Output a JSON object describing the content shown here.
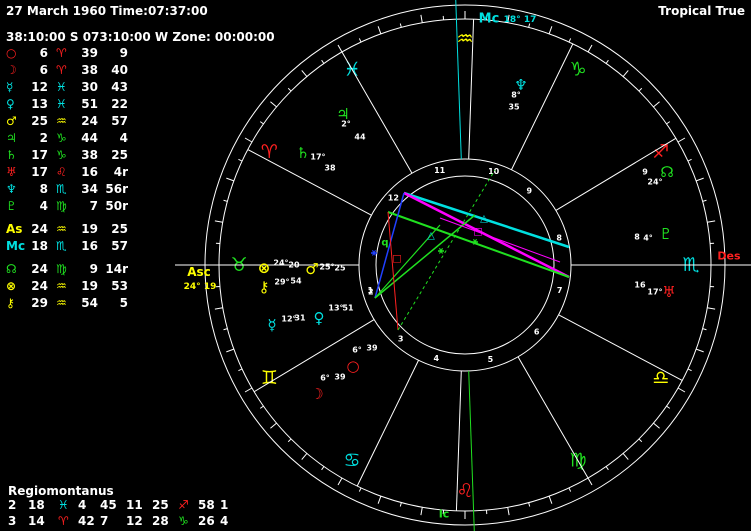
{
  "header": {
    "datetime": "27 March 1960 Time:07:37:00",
    "location": "38:10:00 S 073:10:00 W Zone: 00:00:00",
    "zodiac": "Tropical True"
  },
  "colors": {
    "red": "#ff2020",
    "yellow": "#ffff00",
    "cyan": "#00e0e0",
    "green": "#20e020",
    "white": "#ffffff",
    "magenta": "#ff00ff",
    "blue": "#2040ff"
  },
  "planets": [
    {
      "symbol": "○",
      "name": "Sun",
      "deg": "6",
      "sign": "♈",
      "min": "39",
      "sec": "9",
      "color": "#ff2020"
    },
    {
      "symbol": "☽",
      "name": "Moon",
      "deg": "6",
      "sign": "♈",
      "min": "38",
      "sec": "40",
      "color": "#ff2020"
    },
    {
      "symbol": "☿",
      "name": "Mercury",
      "deg": "12",
      "sign": "♓",
      "min": "30",
      "sec": "43",
      "color": "#00e0e0"
    },
    {
      "symbol": "♀",
      "name": "Venus",
      "deg": "13",
      "sign": "♓",
      "min": "51",
      "sec": "22",
      "color": "#00e0e0"
    },
    {
      "symbol": "♂",
      "name": "Mars",
      "deg": "25",
      "sign": "♒",
      "min": "24",
      "sec": "57",
      "color": "#ffff00"
    },
    {
      "symbol": "♃",
      "name": "Jupiter",
      "deg": "2",
      "sign": "♑",
      "min": "44",
      "sec": "4",
      "color": "#20e020"
    },
    {
      "symbol": "♄",
      "name": "Saturn",
      "deg": "17",
      "sign": "♑",
      "min": "38",
      "sec": "25",
      "color": "#20e020"
    },
    {
      "symbol": "♅",
      "name": "Uranus",
      "deg": "17",
      "sign": "♌",
      "min": "16",
      "sec": "4r",
      "color": "#ff2020"
    },
    {
      "symbol": "♆",
      "name": "Neptune",
      "deg": "8",
      "sign": "♏",
      "min": "34",
      "sec": "56r",
      "color": "#00e0e0"
    },
    {
      "symbol": "♇",
      "name": "Pluto",
      "deg": "4",
      "sign": "♍",
      "min": "7",
      "sec": "50r",
      "color": "#20e020"
    }
  ],
  "angles": [
    {
      "symbol": "As",
      "deg": "24",
      "sign": "♒",
      "min": "19",
      "sec": "25",
      "color": "#ffff00"
    },
    {
      "symbol": "Mc",
      "deg": "18",
      "sign": "♏",
      "min": "16",
      "sec": "57",
      "color": "#00e0e0"
    }
  ],
  "points": [
    {
      "symbol": "☊",
      "deg": "24",
      "sign": "♍",
      "min": "9",
      "sec": "14r",
      "color": "#20e020"
    },
    {
      "symbol": "⊗",
      "deg": "24",
      "sign": "♒",
      "min": "19",
      "sec": "53",
      "color": "#ffff00"
    },
    {
      "symbol": "⚷",
      "deg": "29",
      "sign": "♒",
      "min": "54",
      "sec": "5",
      "color": "#ffff00"
    }
  ],
  "houses": {
    "system": "Regiomontanus",
    "rows": [
      [
        {
          "t": "2",
          "c": "#ffffff"
        },
        {
          "t": "18",
          "c": "#ffffff"
        },
        {
          "t": "♓",
          "c": "#00e0e0"
        },
        {
          "t": "4",
          "c": "#ffffff"
        },
        {
          "t": "45",
          "c": "#ffffff"
        },
        {
          "t": "11",
          "c": "#ffffff"
        },
        {
          "t": "25",
          "c": "#ffffff"
        },
        {
          "t": "♐",
          "c": "#ff2020"
        },
        {
          "t": "58",
          "c": "#ffffff"
        },
        {
          "t": "1",
          "c": "#ffffff"
        }
      ],
      [
        {
          "t": "3",
          "c": "#ffffff"
        },
        {
          "t": "14",
          "c": "#ffffff"
        },
        {
          "t": "♈",
          "c": "#ff2020"
        },
        {
          "t": "42",
          "c": "#ffffff"
        },
        {
          "t": "7",
          "c": "#ffffff"
        },
        {
          "t": "12",
          "c": "#ffffff"
        },
        {
          "t": "28",
          "c": "#ffffff"
        },
        {
          "t": "♑",
          "c": "#20e020"
        },
        {
          "t": "26",
          "c": "#ffffff"
        },
        {
          "t": "4",
          "c": "#ffffff"
        }
      ]
    ]
  },
  "wheel": {
    "asc_label": "Asc",
    "asc_value": "24° 19",
    "mc_label": "Mc",
    "mc_value": "18° 17",
    "des_label": "Des",
    "ic_label": "Ic",
    "house_numbers": [
      "1",
      "2",
      "3",
      "4",
      "5",
      "6",
      "7",
      "8",
      "9",
      "10",
      "11",
      "12"
    ],
    "signs": [
      {
        "glyph": "♈",
        "color": "#ff2020"
      },
      {
        "glyph": "♉",
        "color": "#20e020"
      },
      {
        "glyph": "♊",
        "color": "#ffff00"
      },
      {
        "glyph": "♋",
        "color": "#00e0e0"
      },
      {
        "glyph": "♌",
        "color": "#ff2020"
      },
      {
        "glyph": "♍",
        "color": "#20e020"
      },
      {
        "glyph": "♎",
        "color": "#ffff00"
      },
      {
        "glyph": "♏",
        "color": "#00e0e0"
      },
      {
        "glyph": "♐",
        "color": "#ff2020"
      },
      {
        "glyph": "♑",
        "color": "#20e020"
      },
      {
        "glyph": "♒",
        "color": "#ffff00"
      },
      {
        "glyph": "♓",
        "color": "#00e0e0"
      }
    ],
    "placed": [
      {
        "glyph": "♆",
        "deg": "8°",
        "min": "35",
        "color": "#00e0e0"
      },
      {
        "glyph": "♃",
        "deg": "2°",
        "min": "44",
        "color": "#20e020"
      },
      {
        "glyph": "♄",
        "deg": "17°",
        "min": "38",
        "color": "#20e020"
      },
      {
        "glyph": "☊",
        "deg": "9",
        "min": "24°",
        "color": "#20e020"
      },
      {
        "glyph": "♇",
        "deg": "8",
        "min": "4°",
        "color": "#20e020"
      },
      {
        "glyph": "♅",
        "deg": "16",
        "min": "17°",
        "color": "#ff2020"
      },
      {
        "glyph": "⊗",
        "deg": "24°",
        "min": "20",
        "color": "#ffff00"
      },
      {
        "glyph": "♂",
        "deg": "25°",
        "min": "25",
        "color": "#ffff00"
      },
      {
        "glyph": "⚷",
        "deg": "29°",
        "min": "54",
        "color": "#ffff00"
      },
      {
        "glyph": "☿",
        "deg": "12°",
        "min": "31",
        "color": "#00e0e0"
      },
      {
        "glyph": "♀",
        "deg": "13°",
        "min": "51",
        "color": "#00e0e0"
      },
      {
        "glyph": "○",
        "deg": "6°",
        "min": "39",
        "color": "#ff2020"
      },
      {
        "glyph": "☽",
        "deg": "6°",
        "min": "39",
        "color": "#ff2020"
      }
    ],
    "aspect_glyphs": [
      {
        "glyph": "△",
        "color": "#00e0e0"
      },
      {
        "glyph": "△",
        "color": "#00e0e0"
      },
      {
        "glyph": "□",
        "color": "#ff00ff"
      },
      {
        "glyph": "⚹",
        "color": "#20e020"
      },
      {
        "glyph": "⚹",
        "color": "#20e020"
      },
      {
        "glyph": "q",
        "color": "#20e020"
      },
      {
        "glyph": "□",
        "color": "#ff2020"
      },
      {
        "glyph": "⚹",
        "color": "#2040ff"
      }
    ]
  }
}
